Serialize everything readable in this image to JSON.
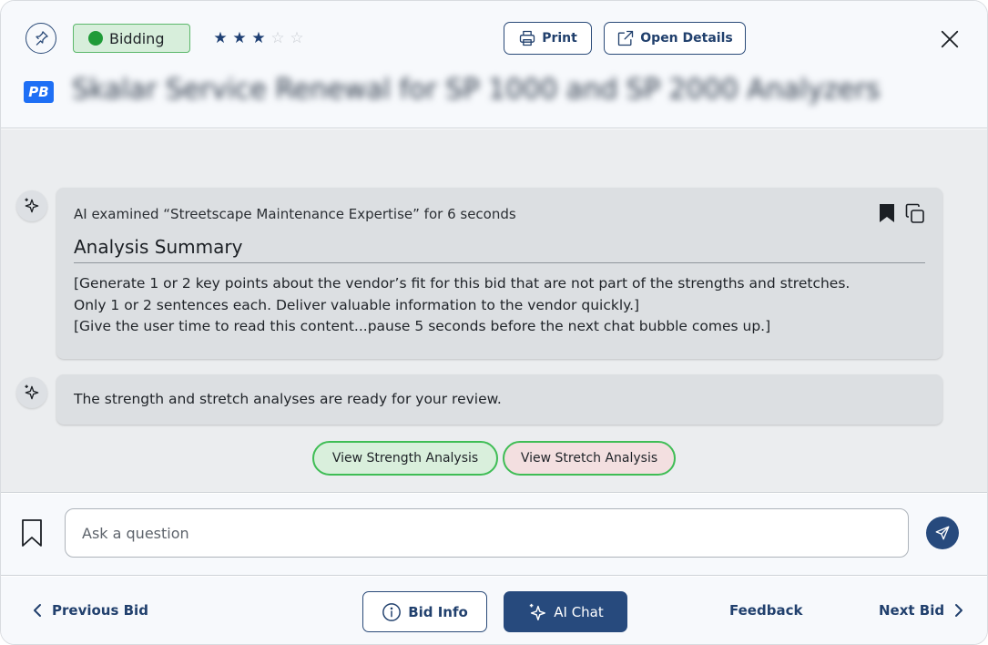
{
  "header": {
    "status_label": "Bidding",
    "status_color": "#1f9b38",
    "rating": 3,
    "rating_max": 5,
    "print_label": "Print",
    "open_details_label": "Open Details",
    "logo_text": "PB",
    "bid_title": "Skalar Service Renewal for SP 1000 and SP 2000 Analyzers"
  },
  "chat": {
    "messages": [
      {
        "meta": "AI examined “Streetscape Maintenance Expertise” for 6 seconds",
        "heading": "Analysis Summary",
        "body_lines": [
          "[Generate 1 or 2 key points about the vendor’s fit for this bid that are not part of the strengths and stretches.",
          "Only 1 or 2 sentences each. Deliver valuable information to the vendor quickly.]",
          "[Give the user time to read this content...pause 5 seconds before the next chat bubble comes up.]"
        ]
      },
      {
        "text": "The strength and stretch analyses are ready for your review."
      }
    ],
    "strength_button": "View Strength Analysis",
    "stretch_button": "View Stretch Analysis"
  },
  "input": {
    "placeholder": "Ask a question",
    "value": ""
  },
  "nav": {
    "previous_label": "Previous Bid",
    "bid_info_label": "Bid Info",
    "ai_chat_label": "AI Chat",
    "feedback_label": "Feedback",
    "next_label": "Next Bid"
  },
  "colors": {
    "primary": "#274a7d",
    "accent_blue": "#1e6ff5",
    "strength_border": "#3fbd55"
  }
}
